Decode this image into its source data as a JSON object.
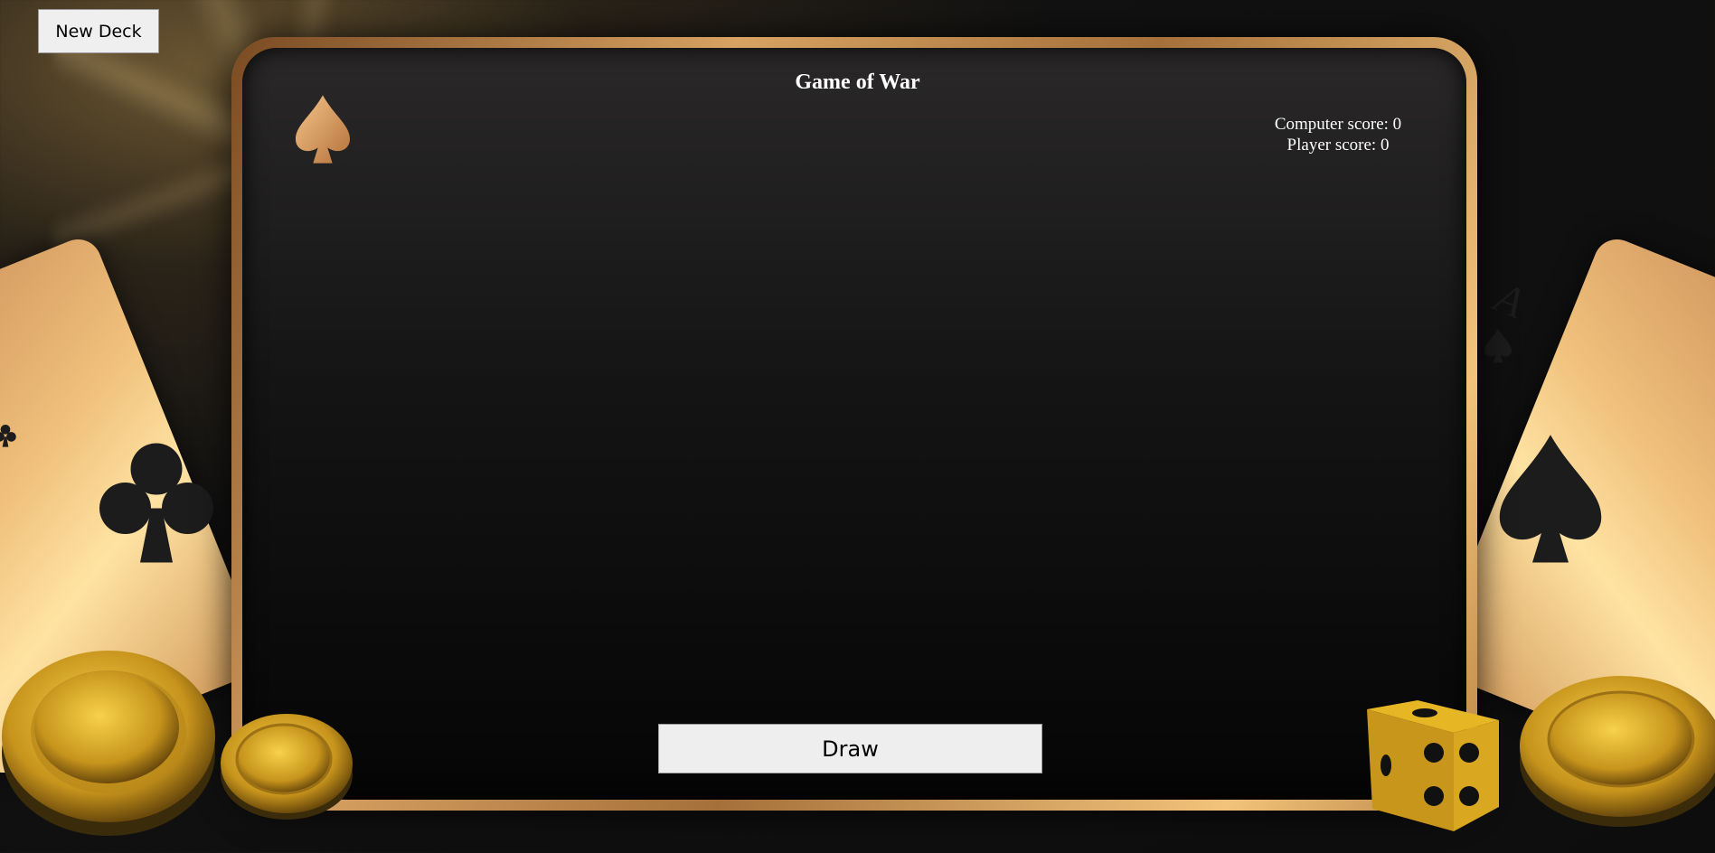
{
  "toolbar": {
    "new_deck_label": "New Deck"
  },
  "game": {
    "title": "Game of War",
    "computer_score_text": "Computer score: 0",
    "player_score_text": "Player score: 0",
    "draw_label": "Draw"
  },
  "cards": {
    "left_suit": "club",
    "right_rank": "A",
    "right_suit": "spade"
  },
  "colors": {
    "gold": "#e2a864",
    "board_dark": "#0a0a0a",
    "button_bg": "#eeeeee",
    "text": "#ffffff"
  },
  "icons": [
    "spade-logo-icon",
    "club-icon",
    "spade-icon",
    "gold-coin-icon",
    "dice-icon"
  ]
}
